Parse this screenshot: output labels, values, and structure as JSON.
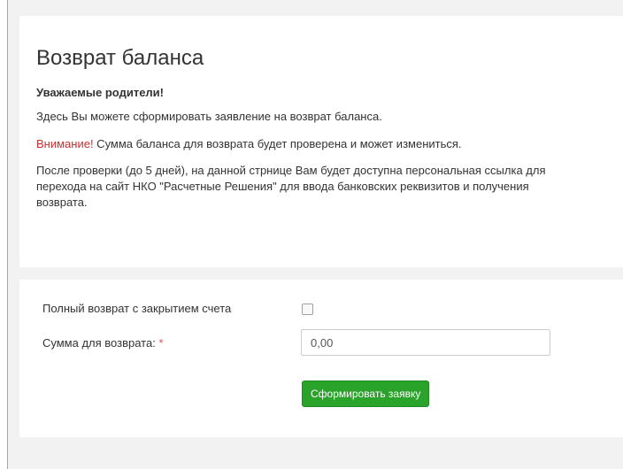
{
  "header": {
    "title": "Возврат баланса"
  },
  "intro": {
    "greeting": "Уважаемые родители!",
    "line1": "Здесь Вы можете сформировать заявление на возврат баланса.",
    "warning_prefix": "Внимание!",
    "warning_text": " Сумма баланса для возврата будет проверена и может измениться.",
    "line3": "После проверки (до 5 дней), на данной стрнице Вам будет доступна персональная ссылка для перехода на сайт НКО \"Расчетные Решения\" для ввода банковских реквизитов и получения возврата."
  },
  "form": {
    "full_refund_label": "Полный возврат с закрытием счета",
    "full_refund_checked": false,
    "amount_label": "Сумма для возврата: ",
    "required_mark": "*",
    "amount_value": "0,00",
    "submit_label": "Сформировать заявку"
  },
  "colors": {
    "warning": "#c9302c",
    "required": "#d9534f",
    "button_bg": "#2aa32a",
    "page_bg": "#f2f2f2"
  }
}
